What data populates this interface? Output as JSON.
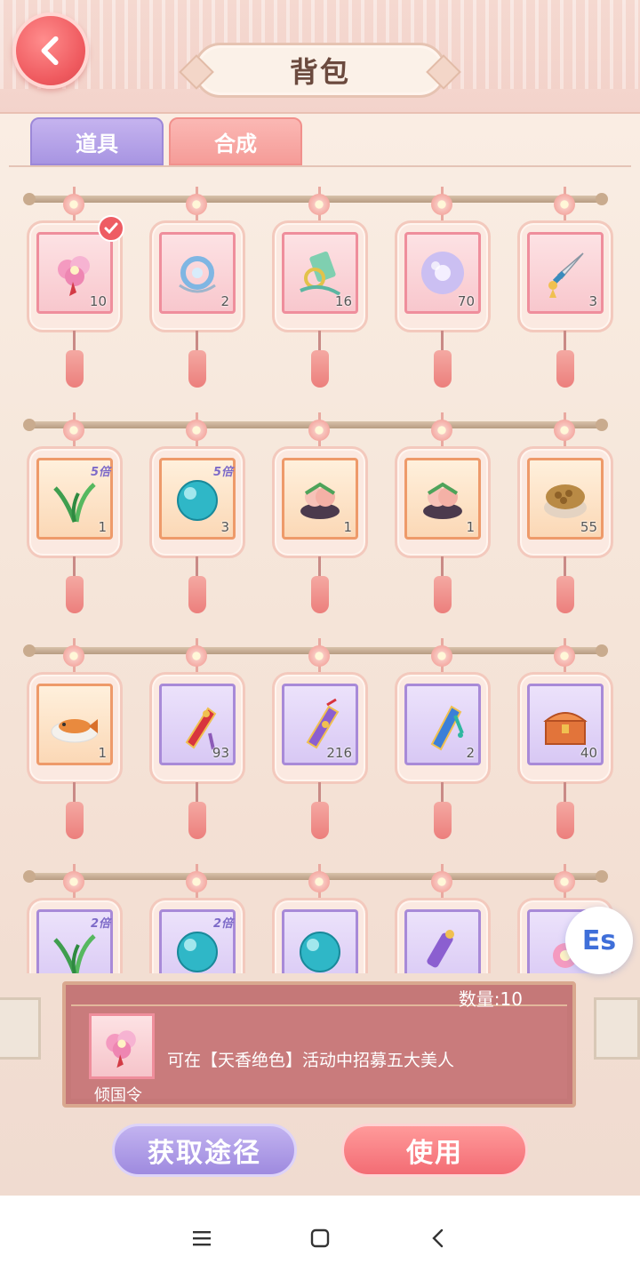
{
  "header": {
    "title": "背包"
  },
  "tabs": [
    {
      "label": "道具",
      "active": true
    },
    {
      "label": "合成",
      "active": false
    }
  ],
  "colors": {
    "accent_pink": "#f36c74",
    "accent_purple": "#9e8adf",
    "panel_red": "#c57878"
  },
  "rows": [
    {
      "items": [
        {
          "icon": "flower-token-icon",
          "count": "10",
          "tile": "pink",
          "selected": true
        },
        {
          "icon": "jade-pendant-icon",
          "count": "2",
          "tile": "pink"
        },
        {
          "icon": "green-scroll-ring-icon",
          "count": "16",
          "tile": "pink"
        },
        {
          "icon": "purple-jade-disc-icon",
          "count": "70",
          "tile": "pink"
        },
        {
          "icon": "dagger-icon",
          "count": "3",
          "tile": "pink"
        }
      ]
    },
    {
      "items": [
        {
          "icon": "orchid-herb-icon",
          "count": "1",
          "tile": "orange",
          "badge": "5倍"
        },
        {
          "icon": "cyan-pearl-icon",
          "count": "3",
          "tile": "orange",
          "badge": "5倍"
        },
        {
          "icon": "peach-basket-icon",
          "count": "1",
          "tile": "orange"
        },
        {
          "icon": "peach-basket-icon",
          "count": "1",
          "tile": "orange"
        },
        {
          "icon": "walnut-basket-icon",
          "count": "55",
          "tile": "orange"
        }
      ]
    },
    {
      "items": [
        {
          "icon": "fish-dish-icon",
          "count": "1",
          "tile": "orange"
        },
        {
          "icon": "red-sachet-icon",
          "count": "93",
          "tile": "purple"
        },
        {
          "icon": "purple-sachet-icon",
          "count": "216",
          "tile": "purple"
        },
        {
          "icon": "blue-sachet-icon",
          "count": "2",
          "tile": "purple"
        },
        {
          "icon": "treasure-chest-icon",
          "count": "40",
          "tile": "purple"
        }
      ]
    },
    {
      "items": [
        {
          "icon": "orchid-herb-icon",
          "count": "",
          "tile": "purple",
          "badge": "2倍"
        },
        {
          "icon": "cyan-pearl-icon",
          "count": "",
          "tile": "purple",
          "badge": "2倍"
        },
        {
          "icon": "cyan-pearl-icon",
          "count": "",
          "tile": "purple"
        },
        {
          "icon": "purple-scroll-icon",
          "count": "",
          "tile": "purple"
        },
        {
          "icon": "pink-item-icon",
          "count": "",
          "tile": "purple"
        }
      ]
    }
  ],
  "detail": {
    "quantity": "数量:10",
    "item_name": "倾国令",
    "description": "可在【天香绝色】活动中招募五大美人"
  },
  "buttons": {
    "get": "获取途径",
    "use": "使用"
  },
  "floating": {
    "label": "Es"
  }
}
